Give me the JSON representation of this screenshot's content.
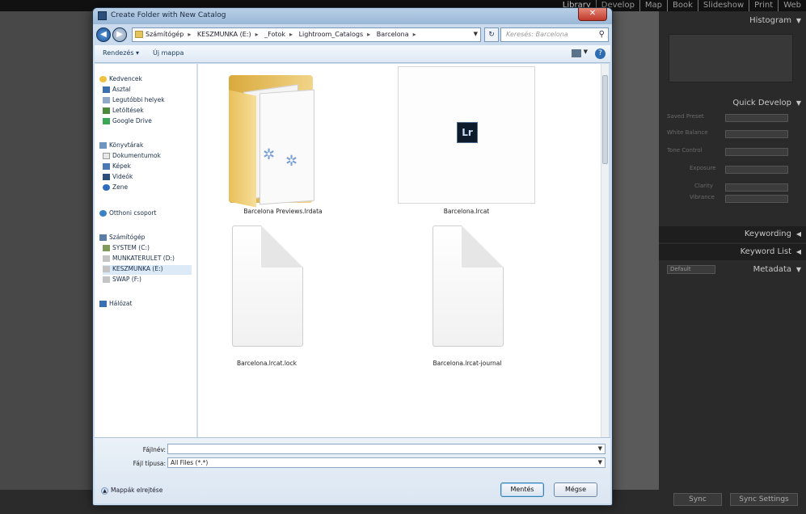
{
  "lightroom": {
    "modules": [
      "Library",
      "Develop",
      "Map",
      "Book",
      "Slideshow",
      "Print",
      "Web"
    ],
    "active_module": "Library",
    "right_panel": {
      "histogram": "Histogram",
      "quick_develop": "Quick Develop",
      "saved_preset": "Saved Preset",
      "white_balance": "White Balance",
      "tone_control": "Tone Control",
      "exposure": "Exposure",
      "clarity": "Clarity",
      "vibrance": "Vibrance",
      "keywording": "Keywording",
      "keyword_list": "Keyword List",
      "metadata": "Metadata",
      "metadata_preset": "Default",
      "sync": "Sync",
      "sync_settings": "Sync Settings"
    }
  },
  "dialog": {
    "title": "Create Folder with New Catalog",
    "close": "✕",
    "breadcrumbs": [
      "Számítógép",
      "KESZMUNKA (E:)",
      "_Fotok",
      "Lightroom_Catalogs",
      "Barcelona"
    ],
    "search_placeholder": "Keresés: Barcelona",
    "toolbar": {
      "organize": "Rendezés ▾",
      "new_folder": "Új mappa"
    },
    "nav_pane": {
      "favorites": "Kedvencek",
      "favorites_items": [
        "Asztal",
        "Legutóbbi helyek",
        "Letöltések",
        "Google Drive"
      ],
      "libraries": "Könyvtárak",
      "libraries_items": [
        "Dokumentumok",
        "Képek",
        "Videók",
        "Zene"
      ],
      "homegroup": "Otthoni csoport",
      "computer": "Számítógép",
      "computer_items": [
        "SYSTEM (C:)",
        "MUNKATERULET (D:)",
        "KESZMUNKA (E:)",
        "SWAP (F:)"
      ],
      "network": "Hálózat"
    },
    "files": [
      {
        "name": "Barcelona Previews.lrdata",
        "kind": "folder"
      },
      {
        "name": "Barcelona.lrcat",
        "kind": "lrcat",
        "badge": "Lr"
      },
      {
        "name": "Barcelona.lrcat.lock",
        "kind": "doc"
      },
      {
        "name": "Barcelona.lrcat-journal",
        "kind": "doc"
      }
    ],
    "filename_label": "Fájlnév:",
    "filename_value": "",
    "filetype_label": "Fájl típusa:",
    "filetype_value": "All Files (*.*)",
    "hide_folders": "Mappák elrejtése",
    "save_button": "Mentés",
    "cancel_button": "Mégse"
  }
}
